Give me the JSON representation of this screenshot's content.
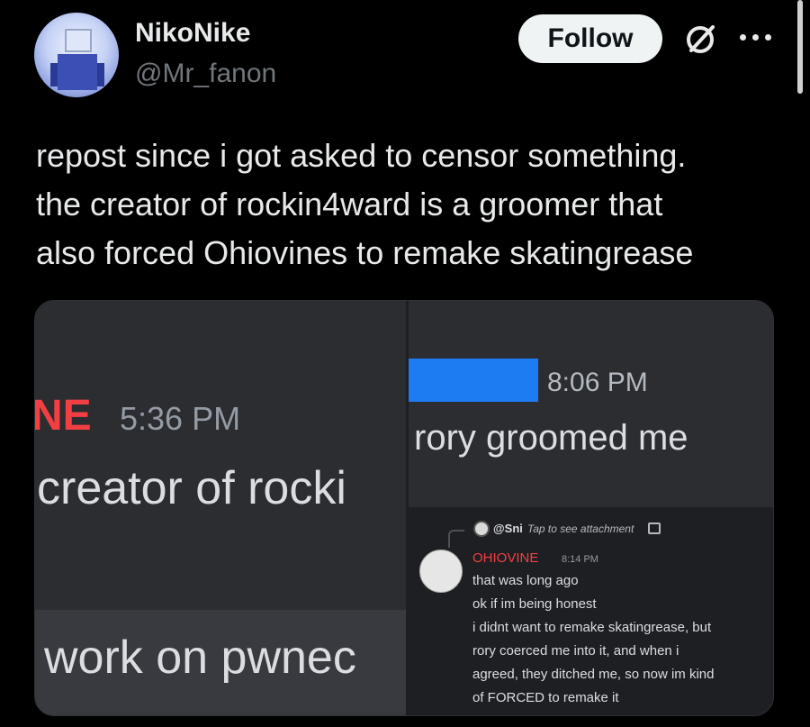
{
  "author": {
    "name": "NikoNike",
    "handle": "@Mr_fanon"
  },
  "actions": {
    "follow_label": "Follow",
    "grok_icon": "grok-icon",
    "more_icon": "more-icon"
  },
  "tweet": {
    "lines": [
      "repost since i got asked to censor something.",
      "the creator of rockin4ward is a groomer that",
      "also forced Ohiovines to remake skatingrease"
    ]
  },
  "media": {
    "left_panel": {
      "author_fragment": "NE",
      "time": "5:36 PM",
      "message_fragment": "creator of rocki",
      "quote_fragment": "work on pwnec"
    },
    "top_right_panel": {
      "time": "8:06 PM",
      "message": "rory groomed me"
    },
    "bottom_right_panel": {
      "reply_user": "@Sni",
      "reply_hint": "Tap to see attachment",
      "author": "OHIOVINE",
      "time": "8:14 PM",
      "lines": [
        "that was long ago",
        "ok if im being honest",
        "i didnt want to remake skatingrease, but",
        "rory coerced me into it, and when i",
        "agreed, they ditched me, so now im kind",
        "of FORCED to remake it"
      ]
    }
  },
  "colors": {
    "background": "#000000",
    "text": "#e7e9ea",
    "muted": "#71767b",
    "discord_red": "#f23f42",
    "censor_blue": "#1d7cf2"
  }
}
